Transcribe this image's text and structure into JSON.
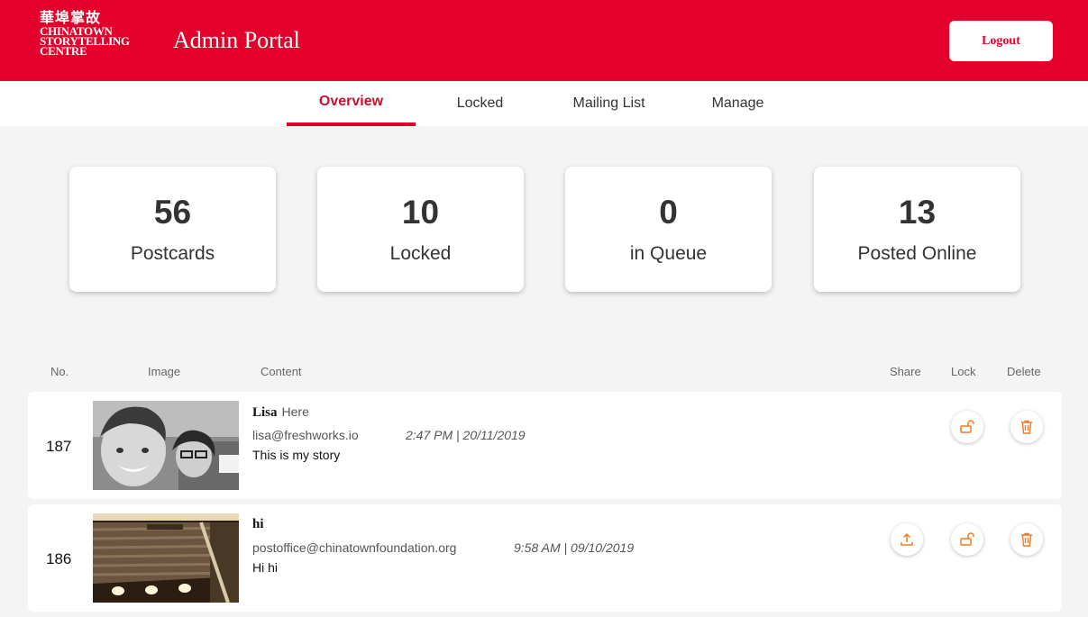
{
  "header": {
    "logo_zh": "華埠掌故",
    "logo_line1": "CHINATOWN",
    "logo_line2": "STORYTELLING",
    "logo_line3": "CENTRE",
    "title": "Admin Portal",
    "logout_label": "Logout"
  },
  "tabs": [
    {
      "label": "Overview",
      "active": true
    },
    {
      "label": "Locked",
      "active": false
    },
    {
      "label": "Mailing List",
      "active": false
    },
    {
      "label": "Manage",
      "active": false
    }
  ],
  "stats": [
    {
      "value": "56",
      "label": "Postcards"
    },
    {
      "value": "10",
      "label": "Locked"
    },
    {
      "value": "0",
      "label": "in Queue"
    },
    {
      "value": "13",
      "label": "Posted Online"
    }
  ],
  "table": {
    "headers": {
      "no": "No.",
      "image": "Image",
      "content": "Content",
      "share": "Share",
      "lock": "Lock",
      "delete": "Delete"
    },
    "rows": [
      {
        "no": "187",
        "name": "Lisa",
        "subtitle": "Here",
        "email": "lisa@freshworks.io",
        "time": "2:47 PM | 20/11/2019",
        "text": "This is my story",
        "image_icon": "selfie-photo",
        "has_share": false
      },
      {
        "no": "186",
        "name": "hi",
        "subtitle": "",
        "email": "postoffice@chinatownfoundation.org",
        "time": "9:58 AM | 09/10/2019",
        "text": "Hi hi",
        "image_icon": "ceiling-photo",
        "has_share": true
      }
    ]
  },
  "colors": {
    "brand": "#e3002a",
    "action_icon": "#f07a2a"
  }
}
